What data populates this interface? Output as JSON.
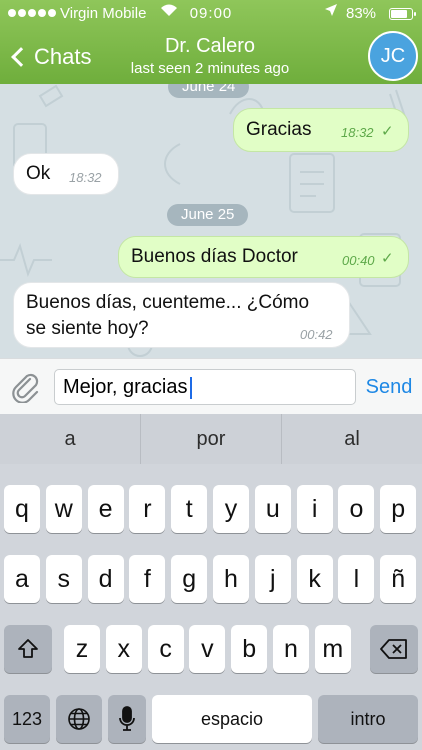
{
  "status_bar": {
    "carrier": "Virgin Mobile",
    "time": "09:00",
    "battery_percent": "83%",
    "battery_level": 0.83
  },
  "header": {
    "back_label": "Chats",
    "contact_name": "Dr. Calero",
    "last_seen": "last seen 2 minutes ago",
    "avatar_initials": "JC",
    "accent_color": "#7dba48",
    "avatar_color": "#4aa3df"
  },
  "chat": {
    "dates": [
      "June 24",
      "June 25"
    ],
    "messages": [
      {
        "direction": "out",
        "text": "Gracias",
        "time": "18:32",
        "read": true
      },
      {
        "direction": "in",
        "text": "Ok",
        "time": "18:32"
      },
      {
        "direction": "out",
        "text": "Buenos días Doctor",
        "time": "00:40",
        "read": true
      },
      {
        "direction": "in",
        "text_line1": "Buenos días, cuenteme... ¿Cómo",
        "text_line2": "se siente hoy?",
        "time": "00:42"
      }
    ]
  },
  "composer": {
    "attach_icon": "paperclip-icon",
    "value": "Mejor, gracias",
    "send_label": "Send",
    "send_color": "#1e88e5"
  },
  "keyboard": {
    "suggestions": [
      "a",
      "por",
      "al"
    ],
    "row1": [
      "q",
      "w",
      "e",
      "r",
      "t",
      "y",
      "u",
      "i",
      "o",
      "p"
    ],
    "row2": [
      "a",
      "s",
      "d",
      "f",
      "g",
      "h",
      "j",
      "k",
      "l",
      "ñ"
    ],
    "row3": [
      "z",
      "x",
      "c",
      "v",
      "b",
      "n",
      "m"
    ],
    "numbers_label": "123",
    "space_label": "espacio",
    "return_label": "intro",
    "shift_icon": "shift-arrow-icon",
    "delete_icon": "backspace-icon",
    "globe_icon": "globe-icon",
    "mic_icon": "microphone-icon"
  }
}
